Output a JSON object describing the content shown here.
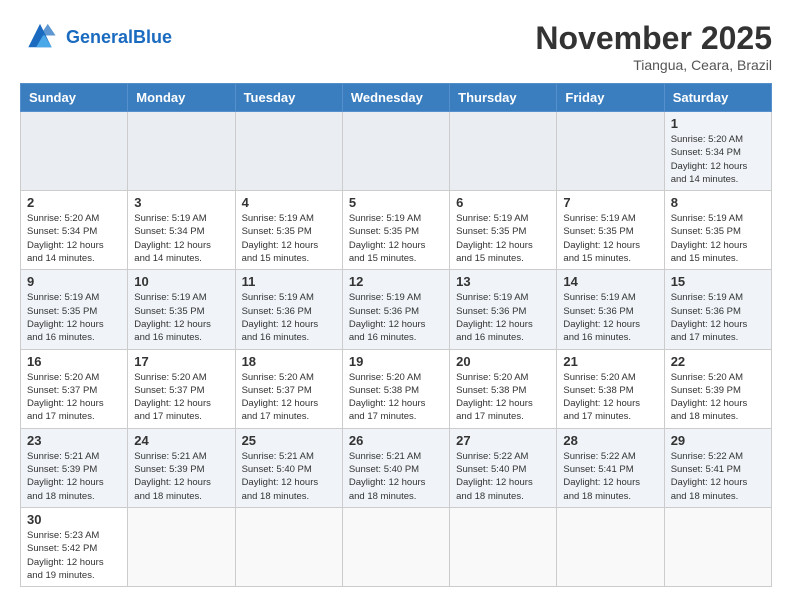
{
  "header": {
    "logo_general": "General",
    "logo_blue": "Blue",
    "month_title": "November 2025",
    "location": "Tiangua, Ceara, Brazil"
  },
  "weekdays": [
    "Sunday",
    "Monday",
    "Tuesday",
    "Wednesday",
    "Thursday",
    "Friday",
    "Saturday"
  ],
  "weeks": [
    [
      {
        "day": "",
        "info": ""
      },
      {
        "day": "",
        "info": ""
      },
      {
        "day": "",
        "info": ""
      },
      {
        "day": "",
        "info": ""
      },
      {
        "day": "",
        "info": ""
      },
      {
        "day": "",
        "info": ""
      },
      {
        "day": "1",
        "info": "Sunrise: 5:20 AM\nSunset: 5:34 PM\nDaylight: 12 hours\nand 14 minutes."
      }
    ],
    [
      {
        "day": "2",
        "info": "Sunrise: 5:20 AM\nSunset: 5:34 PM\nDaylight: 12 hours\nand 14 minutes."
      },
      {
        "day": "3",
        "info": "Sunrise: 5:19 AM\nSunset: 5:34 PM\nDaylight: 12 hours\nand 14 minutes."
      },
      {
        "day": "4",
        "info": "Sunrise: 5:19 AM\nSunset: 5:35 PM\nDaylight: 12 hours\nand 15 minutes."
      },
      {
        "day": "5",
        "info": "Sunrise: 5:19 AM\nSunset: 5:35 PM\nDaylight: 12 hours\nand 15 minutes."
      },
      {
        "day": "6",
        "info": "Sunrise: 5:19 AM\nSunset: 5:35 PM\nDaylight: 12 hours\nand 15 minutes."
      },
      {
        "day": "7",
        "info": "Sunrise: 5:19 AM\nSunset: 5:35 PM\nDaylight: 12 hours\nand 15 minutes."
      },
      {
        "day": "8",
        "info": "Sunrise: 5:19 AM\nSunset: 5:35 PM\nDaylight: 12 hours\nand 15 minutes."
      }
    ],
    [
      {
        "day": "9",
        "info": "Sunrise: 5:19 AM\nSunset: 5:35 PM\nDaylight: 12 hours\nand 16 minutes."
      },
      {
        "day": "10",
        "info": "Sunrise: 5:19 AM\nSunset: 5:35 PM\nDaylight: 12 hours\nand 16 minutes."
      },
      {
        "day": "11",
        "info": "Sunrise: 5:19 AM\nSunset: 5:36 PM\nDaylight: 12 hours\nand 16 minutes."
      },
      {
        "day": "12",
        "info": "Sunrise: 5:19 AM\nSunset: 5:36 PM\nDaylight: 12 hours\nand 16 minutes."
      },
      {
        "day": "13",
        "info": "Sunrise: 5:19 AM\nSunset: 5:36 PM\nDaylight: 12 hours\nand 16 minutes."
      },
      {
        "day": "14",
        "info": "Sunrise: 5:19 AM\nSunset: 5:36 PM\nDaylight: 12 hours\nand 16 minutes."
      },
      {
        "day": "15",
        "info": "Sunrise: 5:19 AM\nSunset: 5:36 PM\nDaylight: 12 hours\nand 17 minutes."
      }
    ],
    [
      {
        "day": "16",
        "info": "Sunrise: 5:20 AM\nSunset: 5:37 PM\nDaylight: 12 hours\nand 17 minutes."
      },
      {
        "day": "17",
        "info": "Sunrise: 5:20 AM\nSunset: 5:37 PM\nDaylight: 12 hours\nand 17 minutes."
      },
      {
        "day": "18",
        "info": "Sunrise: 5:20 AM\nSunset: 5:37 PM\nDaylight: 12 hours\nand 17 minutes."
      },
      {
        "day": "19",
        "info": "Sunrise: 5:20 AM\nSunset: 5:38 PM\nDaylight: 12 hours\nand 17 minutes."
      },
      {
        "day": "20",
        "info": "Sunrise: 5:20 AM\nSunset: 5:38 PM\nDaylight: 12 hours\nand 17 minutes."
      },
      {
        "day": "21",
        "info": "Sunrise: 5:20 AM\nSunset: 5:38 PM\nDaylight: 12 hours\nand 17 minutes."
      },
      {
        "day": "22",
        "info": "Sunrise: 5:20 AM\nSunset: 5:39 PM\nDaylight: 12 hours\nand 18 minutes."
      }
    ],
    [
      {
        "day": "23",
        "info": "Sunrise: 5:21 AM\nSunset: 5:39 PM\nDaylight: 12 hours\nand 18 minutes."
      },
      {
        "day": "24",
        "info": "Sunrise: 5:21 AM\nSunset: 5:39 PM\nDaylight: 12 hours\nand 18 minutes."
      },
      {
        "day": "25",
        "info": "Sunrise: 5:21 AM\nSunset: 5:40 PM\nDaylight: 12 hours\nand 18 minutes."
      },
      {
        "day": "26",
        "info": "Sunrise: 5:21 AM\nSunset: 5:40 PM\nDaylight: 12 hours\nand 18 minutes."
      },
      {
        "day": "27",
        "info": "Sunrise: 5:22 AM\nSunset: 5:40 PM\nDaylight: 12 hours\nand 18 minutes."
      },
      {
        "day": "28",
        "info": "Sunrise: 5:22 AM\nSunset: 5:41 PM\nDaylight: 12 hours\nand 18 minutes."
      },
      {
        "day": "29",
        "info": "Sunrise: 5:22 AM\nSunset: 5:41 PM\nDaylight: 12 hours\nand 18 minutes."
      }
    ],
    [
      {
        "day": "30",
        "info": "Sunrise: 5:23 AM\nSunset: 5:42 PM\nDaylight: 12 hours\nand 19 minutes."
      },
      {
        "day": "",
        "info": ""
      },
      {
        "day": "",
        "info": ""
      },
      {
        "day": "",
        "info": ""
      },
      {
        "day": "",
        "info": ""
      },
      {
        "day": "",
        "info": ""
      },
      {
        "day": "",
        "info": ""
      }
    ]
  ]
}
